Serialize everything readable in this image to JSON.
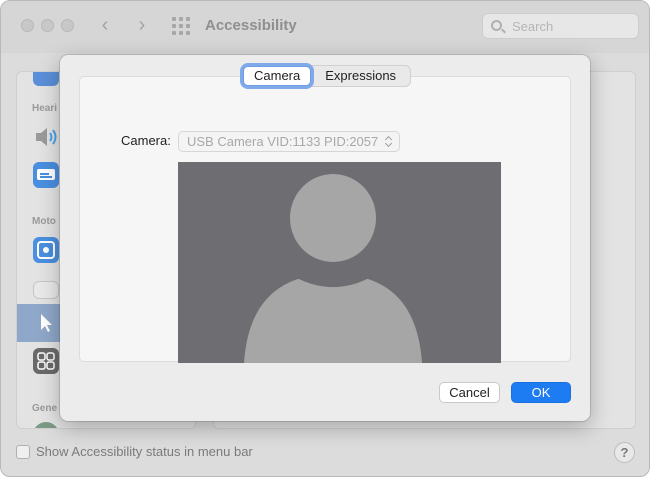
{
  "window": {
    "title": "Accessibility",
    "search_placeholder": "Search"
  },
  "sidebar": {
    "sections": [
      {
        "heading": "Heari"
      },
      {
        "heading": "Moto"
      },
      {
        "heading": "Gene"
      }
    ]
  },
  "footer": {
    "status_label": "Show Accessibility status in menu bar",
    "help_label": "?"
  },
  "sheet": {
    "tabs": [
      {
        "label": "Camera",
        "selected": true
      },
      {
        "label": "Expressions",
        "selected": false
      }
    ],
    "camera_label": "Camera:",
    "camera_value": "USB Camera VID:1133 PID:2057",
    "cancel_label": "Cancel",
    "ok_label": "OK"
  },
  "colors": {
    "accent": "#1d7cf2",
    "tab_focus": "#7fa9e8",
    "preview_bg": "#6e6e72",
    "silhouette": "#a6a6a6"
  }
}
